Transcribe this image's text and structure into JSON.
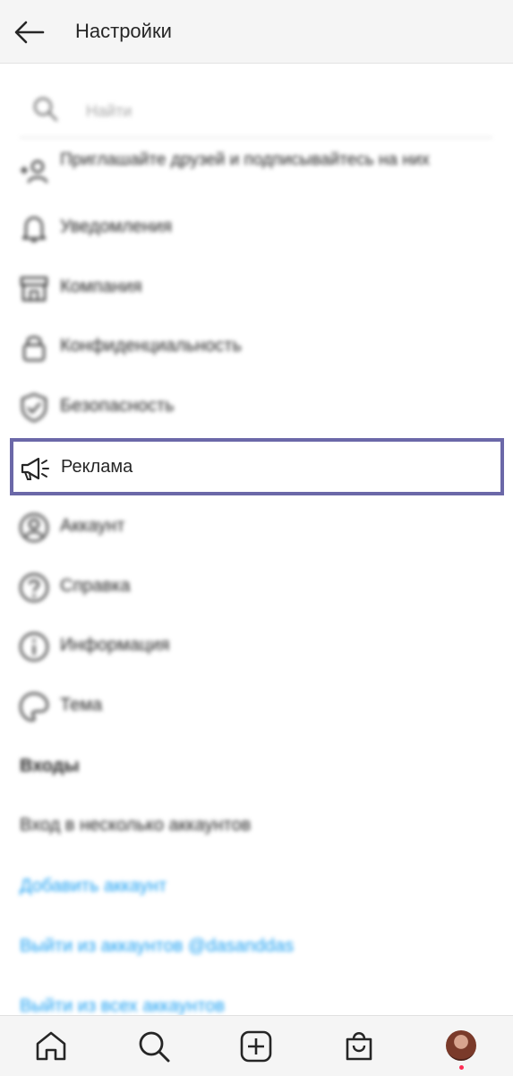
{
  "header": {
    "title": "Настройки"
  },
  "search": {
    "placeholder": "Найти"
  },
  "menu": [
    {
      "label": "Приглашайте друзей и подписывайтесь на них",
      "icon": "add-person-icon"
    },
    {
      "label": "Уведомления",
      "icon": "bell-icon"
    },
    {
      "label": "Компания",
      "icon": "shop-icon"
    },
    {
      "label": "Конфиденциальность",
      "icon": "lock-icon"
    },
    {
      "label": "Безопасность",
      "icon": "shield-icon"
    },
    {
      "label": "Реклама",
      "icon": "megaphone-icon"
    },
    {
      "label": "Аккаунт",
      "icon": "user-circle-icon"
    },
    {
      "label": "Справка",
      "icon": "help-icon"
    },
    {
      "label": "Информация",
      "icon": "info-icon"
    },
    {
      "label": "Тема",
      "icon": "palette-icon"
    }
  ],
  "logins": {
    "heading": "Входы",
    "multi": "Вход в несколько аккаунтов",
    "add": "Добавить аккаунт",
    "logout_user": "Выйти из аккаунтов @dasanddas",
    "logout_all": "Выйти из всех аккаунтов"
  },
  "colors": {
    "link": "#1a9ff2",
    "highlight_border": "#6b68a8"
  },
  "tabbar": [
    "home-icon",
    "search-icon",
    "new-post-icon",
    "shop-icon",
    "profile-avatar"
  ]
}
